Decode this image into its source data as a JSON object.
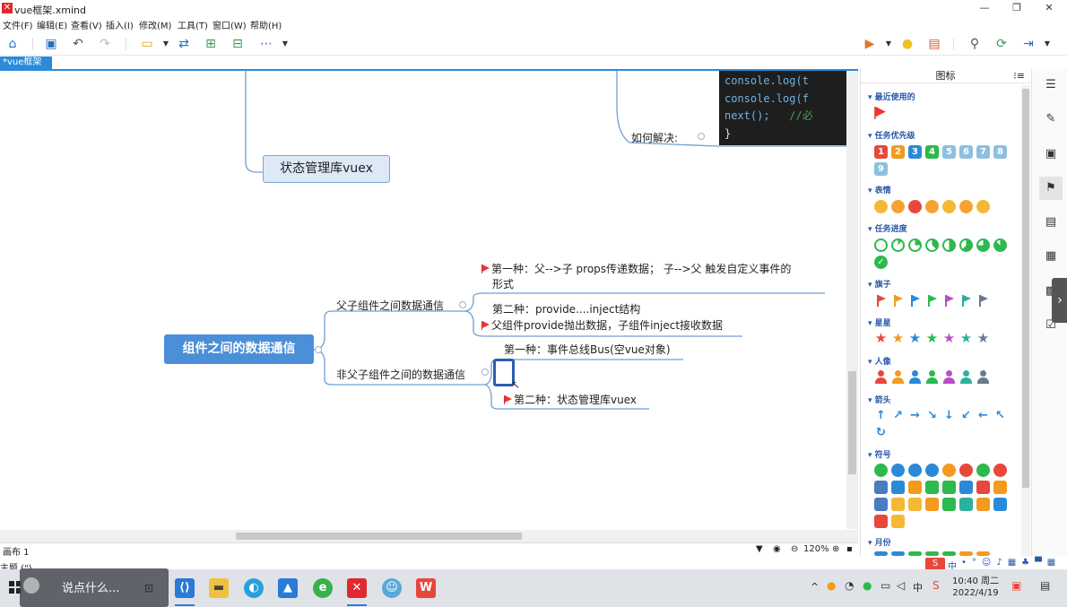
{
  "window": {
    "title": "vue框架.xmind",
    "app_icon": "x-logo-icon",
    "minimize": "—",
    "maximize": "❐",
    "close": "✕"
  },
  "menu": [
    "文件(F)",
    "编辑(E)",
    "查看(V)",
    "插入(I)",
    "修改(M)",
    "工具(T)",
    "窗口(W)",
    "帮助(H)"
  ],
  "tab": {
    "label": "*vue框架",
    "close": "✕"
  },
  "code_lines": [
    {
      "code": "console.log(t",
      "comment": ""
    },
    {
      "code": "console.log(f",
      "comment": ""
    },
    {
      "code": "next();",
      "comment": "//必"
    },
    {
      "code": "}",
      "comment": ""
    }
  ],
  "mindmap": {
    "how_to_solve": "如何解决:",
    "vuex_topic": "状态管理库vuex",
    "main_topic": "组件之间的数据通信",
    "branch1": {
      "label": "父子组件之间数据通信",
      "item1_line1": "第一种：父-->子  props传递数据；    子-->父 触发自定义事件的",
      "item1_line2": "形式",
      "item2_line1": "第二种：provide....inject结构",
      "item2_line2": "父组件provide抛出数据，子组件inject接收数据"
    },
    "branch2": {
      "label": "非父子组件之间的数据通信",
      "item1": "第一种：事件总线Bus(空vue对象)",
      "item2": "第二种：状态管理库vuex"
    }
  },
  "status": {
    "canvas": "画布 1",
    "zoom": "120%",
    "theme": "主题 (\")"
  },
  "panel": {
    "title": "图标",
    "sections": {
      "recent": "最近使用的",
      "priority": "任务优先级",
      "emoji": "表情",
      "progress": "任务进度",
      "flags": "旗子",
      "stars": "星星",
      "people": "人像",
      "arrows": "箭头",
      "symbols": "符号",
      "month": "月份"
    },
    "priority_numbers": [
      "1",
      "2",
      "3",
      "4",
      "5",
      "6",
      "7",
      "8",
      "9"
    ],
    "priority_colors": [
      "#e8473c",
      "#f39a1f",
      "#2a8ad8",
      "#2db94d",
      "#8cc0e0",
      "#8cc0e0",
      "#8cc0e0",
      "#8cc0e0",
      "#8cc0e0"
    ],
    "flag_colors": [
      "#e8473c",
      "#f39a1f",
      "#2a8ad8",
      "#2db94d",
      "#b84fc5",
      "#2ab19d",
      "#6b7a8f"
    ],
    "star_colors": [
      "#e8473c",
      "#f39a1f",
      "#2a8ad8",
      "#2db94d",
      "#b84fc5",
      "#2ab19d",
      "#6b7a8f"
    ],
    "people_colors": [
      "#e8473c",
      "#f39a1f",
      "#2a8ad8",
      "#2db94d",
      "#b84fc5",
      "#2ab19d",
      "#6b7a8f"
    ]
  },
  "taskbar": {
    "search_placeholder": "说点什么...",
    "time": "10:40 周二",
    "date": "2022/4/19",
    "ime_zh": "中",
    "tray_zh": "中"
  }
}
